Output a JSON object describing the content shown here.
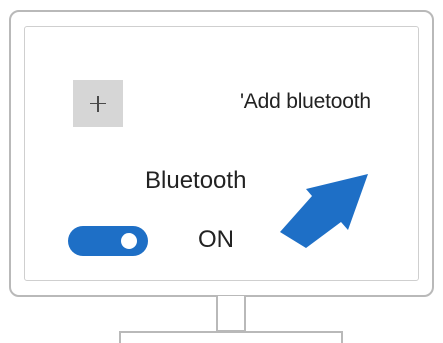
{
  "add_bluetooth": {
    "icon": "plus-icon",
    "label": "'Add bluetooth"
  },
  "bluetooth": {
    "title": "Bluetooth",
    "toggle_state": "on",
    "state_label": "ON"
  },
  "colors": {
    "accent": "#1e6fc6",
    "add_button_bg": "#d6d6d6",
    "frame": "#b9b9b9",
    "text": "#222222"
  },
  "annotation": {
    "icon": "arrow-icon"
  }
}
